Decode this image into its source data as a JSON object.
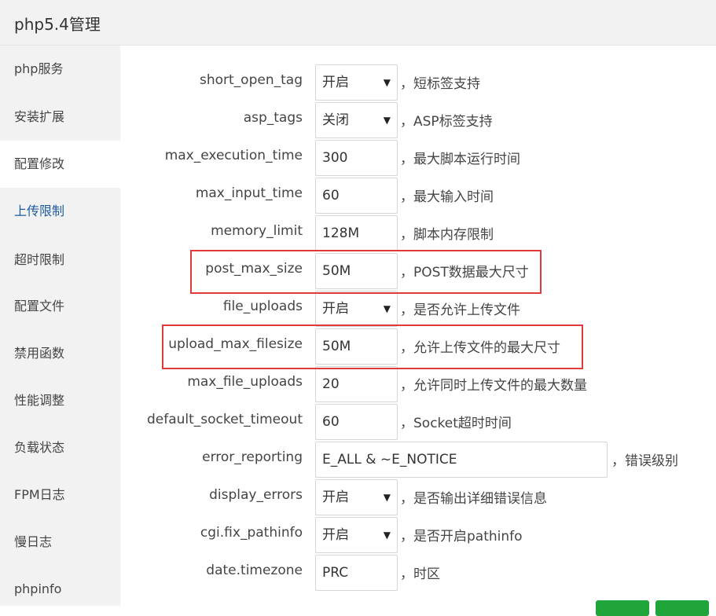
{
  "header": {
    "title": "php5.4管理"
  },
  "sidebar": {
    "items": [
      {
        "label": "php服务"
      },
      {
        "label": "安装扩展"
      },
      {
        "label": "配置修改"
      },
      {
        "label": "上传限制"
      },
      {
        "label": "超时限制"
      },
      {
        "label": "配置文件"
      },
      {
        "label": "禁用函数"
      },
      {
        "label": "性能调整"
      },
      {
        "label": "负载状态"
      },
      {
        "label": "FPM日志"
      },
      {
        "label": "慢日志"
      },
      {
        "label": "phpinfo"
      }
    ]
  },
  "settings": {
    "short_open_tag": {
      "label": "short_open_tag",
      "value": "开启",
      "desc": "，短标签支持"
    },
    "asp_tags": {
      "label": "asp_tags",
      "value": "关闭",
      "desc": "，ASP标签支持"
    },
    "max_execution_time": {
      "label": "max_execution_time",
      "value": "300",
      "desc": "，最大脚本运行时间"
    },
    "max_input_time": {
      "label": "max_input_time",
      "value": "60",
      "desc": "，最大输入时间"
    },
    "memory_limit": {
      "label": "memory_limit",
      "value": "128M",
      "desc": "，脚本内存限制"
    },
    "post_max_size": {
      "label": "post_max_size",
      "value": "50M",
      "desc": "，POST数据最大尺寸"
    },
    "file_uploads": {
      "label": "file_uploads",
      "value": "开启",
      "desc": "，是否允许上传文件"
    },
    "upload_max_filesize": {
      "label": "upload_max_filesize",
      "value": "50M",
      "desc": "，允许上传文件的最大尺寸"
    },
    "max_file_uploads": {
      "label": "max_file_uploads",
      "value": "20",
      "desc": "，允许同时上传文件的最大数量"
    },
    "default_socket_timeout": {
      "label": "default_socket_timeout",
      "value": "60",
      "desc": "，Socket超时时间"
    },
    "error_reporting": {
      "label": "error_reporting",
      "value": "E_ALL & ~E_NOTICE",
      "desc": "，错误级别"
    },
    "display_errors": {
      "label": "display_errors",
      "value": "开启",
      "desc": "，是否输出详细错误信息"
    },
    "cgi_fix_pathinfo": {
      "label": "cgi.fix_pathinfo",
      "value": "开启",
      "desc": "，是否开启pathinfo"
    },
    "date_timezone": {
      "label": "date.timezone",
      "value": "PRC",
      "desc": "，时区"
    }
  },
  "icons": {
    "select_arrow": "▼"
  },
  "colors": {
    "highlight_box": "#e13a3a",
    "active_nav_text": "#1e5b9e",
    "button_green": "#20a53a"
  }
}
